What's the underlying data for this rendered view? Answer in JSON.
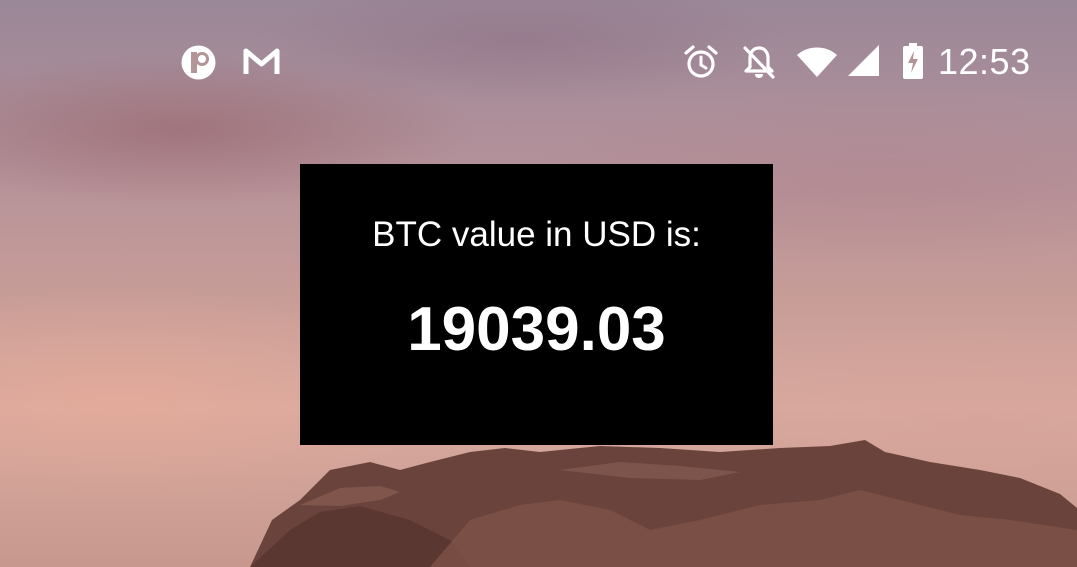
{
  "status_bar": {
    "time": "12:53",
    "left_icons": [
      "notification-app-icon",
      "gmail-icon"
    ],
    "right_icons": [
      "alarm-icon",
      "notifications-off-icon",
      "wifi-icon",
      "cellular-signal-icon",
      "battery-charging-icon"
    ]
  },
  "widget": {
    "label": "BTC value in USD is:",
    "value": "19039.03"
  },
  "colors": {
    "widget_background": "#000000",
    "text": "#ffffff"
  }
}
